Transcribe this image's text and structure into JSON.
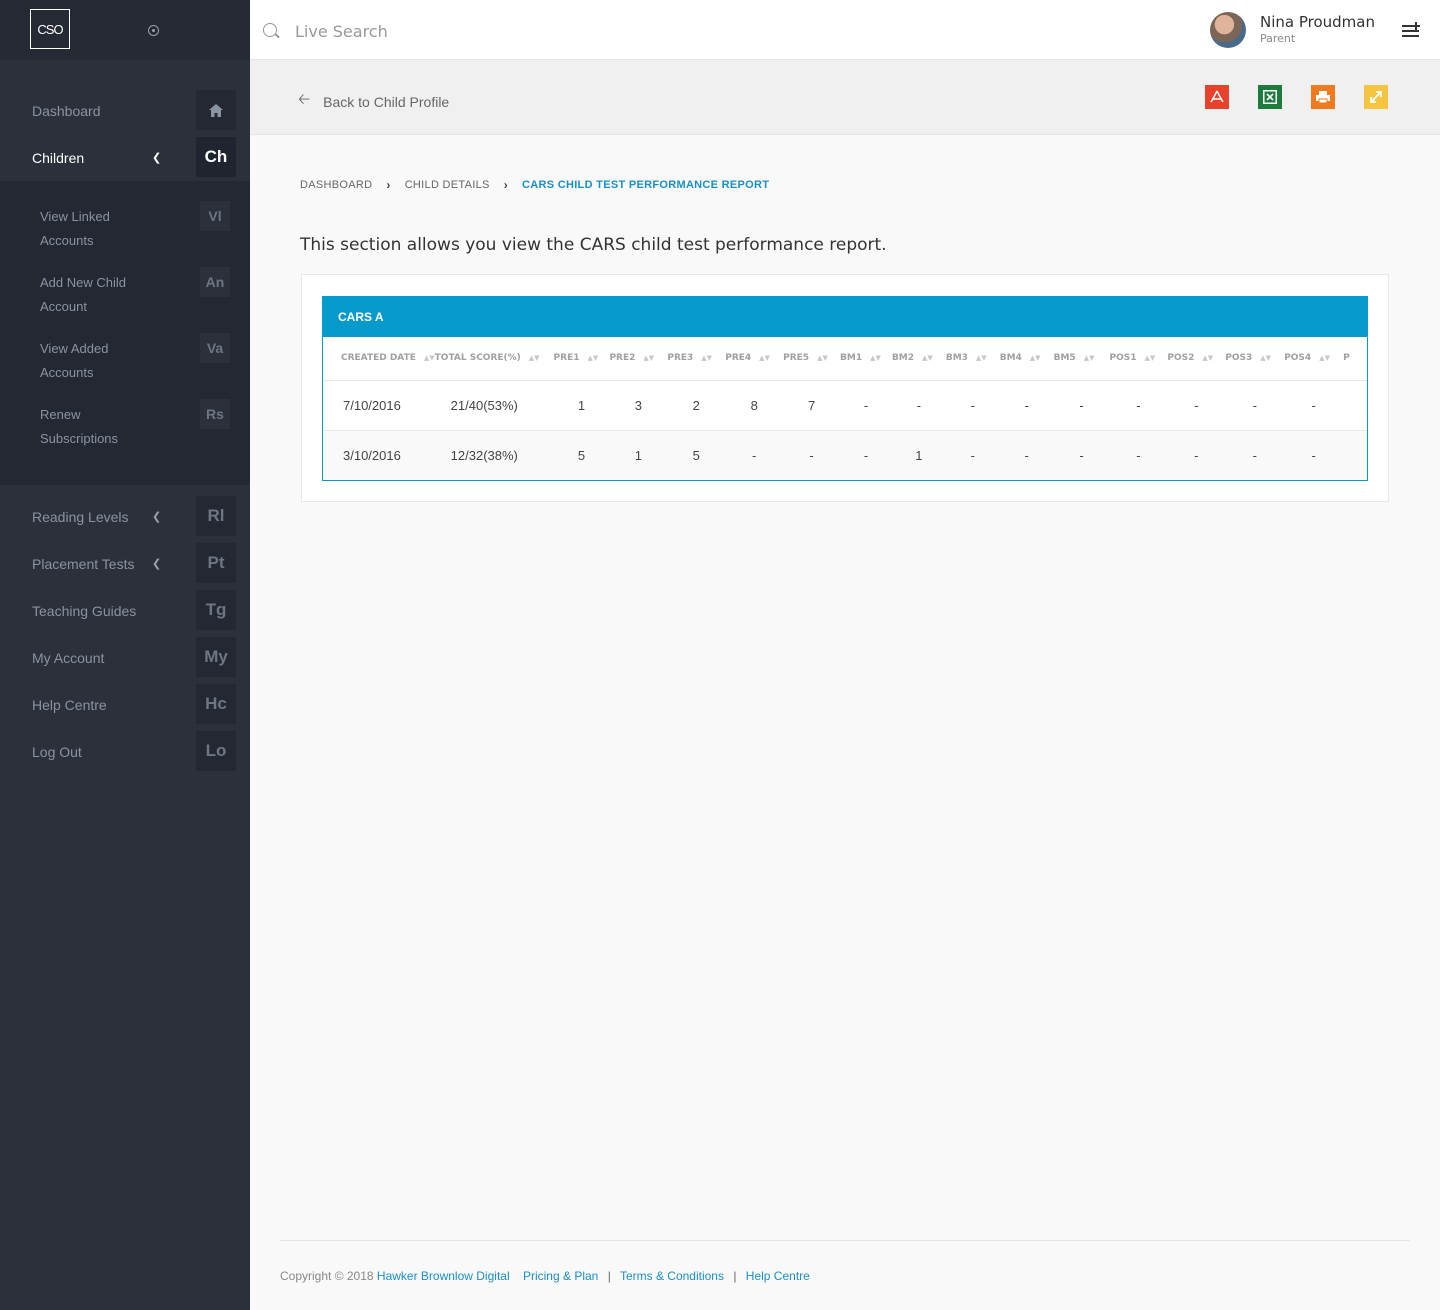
{
  "logo": "CSO",
  "sidebar": {
    "items": [
      {
        "label": "Dashboard",
        "badge": "",
        "icon": "home-icon"
      },
      {
        "label": "Children",
        "badge": "Ch"
      },
      {
        "label": "Reading Levels",
        "badge": "Rl"
      },
      {
        "label": "Placement Tests",
        "badge": "Pt"
      },
      {
        "label": "Teaching Guides",
        "badge": "Tg"
      },
      {
        "label": "My Account",
        "badge": "My"
      },
      {
        "label": "Help Centre",
        "badge": "Hc"
      },
      {
        "label": "Log Out",
        "badge": "Lo"
      }
    ],
    "children_sub": [
      {
        "label": "View Linked Accounts",
        "badge": "Vl"
      },
      {
        "label": "Add New Child Account",
        "badge": "An"
      },
      {
        "label": "View Added Accounts",
        "badge": "Va"
      },
      {
        "label": "Renew Subscriptions",
        "badge": "Rs"
      }
    ]
  },
  "topbar": {
    "search_placeholder": "Live Search",
    "user_name": "Nina Proudman",
    "user_role": "Parent"
  },
  "header": {
    "back_label": "Back to Child Profile",
    "exports": [
      {
        "name": "pdf-icon",
        "color": "#e8412c"
      },
      {
        "name": "excel-icon",
        "color": "#1f7a3d"
      },
      {
        "name": "print-icon",
        "color": "#f07a1c"
      },
      {
        "name": "expand-icon",
        "color": "#f5c542"
      }
    ]
  },
  "breadcrumb": {
    "items": [
      "DASHBOARD",
      "CHILD DETAILS"
    ],
    "current": "CARS CHILD TEST PERFORMANCE REPORT"
  },
  "intro": "This section allows you view the CARS child test performance report.",
  "panel": {
    "title": "CARS A",
    "columns": [
      "CREATED DATE",
      "TOTAL SCORE(%)",
      "PRE1",
      "PRE2",
      "PRE3",
      "PRE4",
      "PRE5",
      "BM1",
      "BM2",
      "BM3",
      "BM4",
      "BM5",
      "POS1",
      "POS2",
      "POS3",
      "POS4",
      "P"
    ],
    "rows": [
      [
        "7/10/2016",
        "21/40(53%)",
        "1",
        "3",
        "2",
        "8",
        "7",
        "-",
        "-",
        "-",
        "-",
        "-",
        "-",
        "-",
        "-",
        "-",
        ""
      ],
      [
        "3/10/2016",
        "12/32(38%)",
        "5",
        "1",
        "5",
        "-",
        "-",
        "-",
        "1",
        "-",
        "-",
        "-",
        "-",
        "-",
        "-",
        "-",
        ""
      ]
    ]
  },
  "footer": {
    "copyright": "Copyright © 2018",
    "company": "Hawker Brownlow Digital",
    "links": [
      "Pricing & Plan",
      "Terms & Conditions",
      "Help Centre"
    ]
  }
}
